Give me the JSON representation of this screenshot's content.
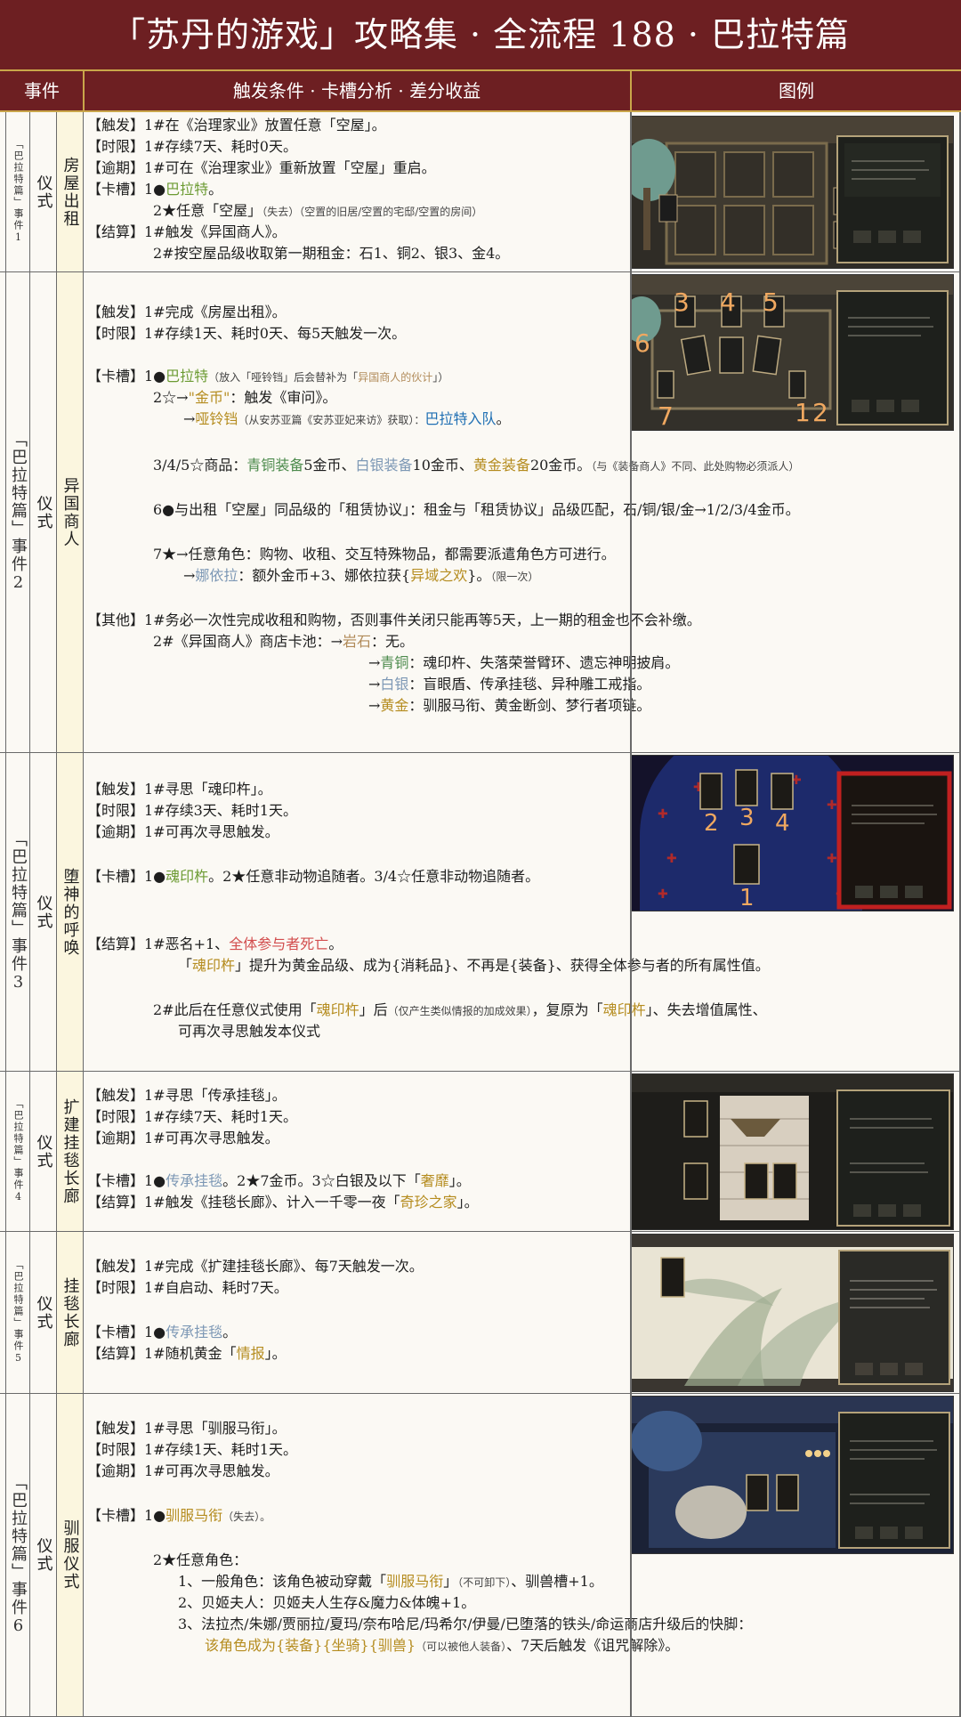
{
  "title": "「苏丹的游戏」攻略集 · 全流程 188 · 巴拉特篇",
  "header": {
    "col_event": "事件",
    "col_content": "触发条件 · 卡槽分析 · 差分收益",
    "col_image": "图例"
  },
  "events": [
    {
      "chapter": "「巴拉特篇」事件1",
      "type": "仪式",
      "name": "房屋出租",
      "lines": [
        {
          "t": "【触发】1#在《治理家业》放置任意「空屋」。"
        },
        {
          "t": "【时限】1#存续7天、耗时0天。"
        },
        {
          "t": "【逾期】1#可在《治理家业》重新放置「空屋」重启。"
        },
        {
          "a": "【卡槽】1●",
          "b": "巴拉特",
          "c": "。"
        },
        {
          "a": "2★任意「空屋」",
          "b": "（失去）（空置的旧居/空置的宅邸/空置的房间）"
        },
        {
          "t": "【结算】1#触发《异国商人》。"
        },
        {
          "t": "2#按空屋品级收取第一期租金：石1、铜2、银3、金4。"
        }
      ]
    },
    {
      "chapter": "「巴拉特篇」事件2",
      "type": "仪式",
      "name": "异国商人",
      "picture_numbers": [
        "3",
        "4",
        "5",
        "6",
        "7",
        "1",
        "2"
      ],
      "lines": [
        {
          "t": "【触发】1#完成《房屋出租》。"
        },
        {
          "t": "【时限】1#存续1天、耗时0天、每5天触发一次。"
        },
        {
          "a": "【卡槽】1●",
          "b": "巴拉特",
          "c": "（放入「哑铃铛」后会替补为「",
          "d": "异国商人的伙计",
          "e": "」）"
        },
        {
          "a": "2☆→",
          "b": "\"金币\"",
          "c": "：触发《审问》。"
        },
        {
          "a": "→",
          "b": "哑铃铛",
          "c": "（从安苏亚篇《安苏亚妃来访》获取）：",
          "d": "巴拉特入队",
          "e": "。"
        },
        {
          "a": "3/4/5☆商品：",
          "b": "青铜装备",
          "c": "5金币、",
          "d": "白银装备",
          "e": "10金币、",
          "f": "黄金装备",
          "g": "20金币。",
          "h": "（与《装备商人》不同、此处购物必须派人）"
        },
        {
          "t": "6●与出租「空屋」同品级的「租赁协议」：租金与「租赁协议」品级匹配，石/铜/银/金→1/2/3/4金币。"
        },
        {
          "t": "7★→任意角色：购物、收租、交互特殊物品，都需要派遣角色方可进行。"
        },
        {
          "a": "→",
          "b": "娜依拉",
          "c": "：额外金币+3、娜依拉获{",
          "d": "异域之欢",
          "e": "}。",
          "f": "（限一次）"
        },
        {
          "t": "【其他】1#务必一次性完成收租和购物，否则事件关闭只能再等5天，上一期的租金也不会补缴。"
        },
        {
          "t": "2#《异国商人》商店卡池：→"
        },
        {
          "a": "岩石",
          "b": "：无。"
        },
        {
          "a": "→",
          "b": "青铜",
          "c": "：魂印杵、失落荣誉臂环、遗忘神明披肩。"
        },
        {
          "a": "→",
          "b": "白银",
          "c": "：盲眼盾、传承挂毯、异种雕工戒指。"
        },
        {
          "a": "→",
          "b": "黄金",
          "c": "：驯服马衔、黄金断剑、梦行者项链。"
        }
      ]
    },
    {
      "chapter": "「巴拉特篇」事件3",
      "type": "仪式",
      "name": "堕神的呼唤",
      "picture_numbers": [
        "2",
        "3",
        "4",
        "1"
      ],
      "lines": [
        {
          "t": "【触发】1#寻思「魂印杵」。"
        },
        {
          "t": "【时限】1#存续3天、耗时1天。"
        },
        {
          "t": "【逾期】1#可再次寻思触发。"
        },
        {
          "a": "【卡槽】1●",
          "b": "魂印杵",
          "c": "。2★任意非动物追随者。3/4☆任意非动物追随者。"
        },
        {
          "a": "【结算】1#恶名+1、",
          "b": "全体参与者死亡",
          "c": "。"
        },
        {
          "a": "「",
          "b": "魂印杵",
          "c": "」提升为黄金品级、成为{消耗品}、不再是{装备}、获得全体参与者的所有属性值。"
        },
        {
          "a": "2#此后在任意仪式使用「",
          "b": "魂印杵",
          "c": "」后",
          "d": "（仅产生类似情报的加成效果）",
          "e": "，复原为「",
          "f": "魂印杵",
          "g": "」、失去增值属性、"
        },
        {
          "t": "可再次寻思触发本仪式"
        }
      ]
    },
    {
      "chapter": "「巴拉特篇」事件4",
      "type": "仪式",
      "name": "扩建挂毯长廊",
      "lines": [
        {
          "t": "【触发】1#寻思「传承挂毯」。"
        },
        {
          "t": "【时限】1#存续7天、耗时1天。"
        },
        {
          "t": "【逾期】1#可再次寻思触发。"
        },
        {
          "a": "【卡槽】1●",
          "b": "传承挂毯",
          "c": "。2★7金币。3☆白银及以下「",
          "d": "奢靡",
          "e": "」。"
        },
        {
          "a": "【结算】1#触发《挂毯长廊》、计入一千零一夜「",
          "b": "奇珍之家",
          "c": "」。"
        }
      ]
    },
    {
      "chapter": "「巴拉特篇」事件5",
      "type": "仪式",
      "name": "挂毯长廊",
      "lines": [
        {
          "t": "【触发】1#完成《扩建挂毯长廊》、每7天触发一次。"
        },
        {
          "t": "【时限】1#自启动、耗时7天。"
        },
        {
          "a": "【卡槽】1●",
          "b": "传承挂毯",
          "c": "。"
        },
        {
          "a": "【结算】1#随机黄金「",
          "b": "情报",
          "c": "」。"
        }
      ]
    },
    {
      "chapter": "「巴拉特篇」事件6",
      "type": "仪式",
      "name": "驯服仪式",
      "lines": [
        {
          "t": "【触发】1#寻思「驯服马衔」。"
        },
        {
          "t": "【时限】1#存续1天、耗时1天。"
        },
        {
          "t": "【逾期】1#可再次寻思触发。"
        },
        {
          "a": "【卡槽】1●",
          "b": "驯服马衔",
          "c": "（失去）。"
        },
        {
          "t": "2★任意角色："
        },
        {
          "a": "1、一般角色：该角色被动穿戴「",
          "b": "驯服马衔",
          "c": "」",
          "d": "（不可卸下）",
          "e": "、驯兽槽+1。"
        },
        {
          "t": "2、贝姬夫人：贝姬夫人生存&魔力&体魄+1。"
        },
        {
          "t": "3、法拉杰/朱娜/贾丽拉/夏玛/奈布哈尼/玛希尔/伊曼/已堕落的铁头/命运商店升级后的快脚："
        },
        {
          "a": "该角色成为{装备}{坐骑}{驯兽}",
          "b": "（可以被他人装备）",
          "c": "、7天后触发《诅咒解除》。"
        }
      ]
    }
  ]
}
